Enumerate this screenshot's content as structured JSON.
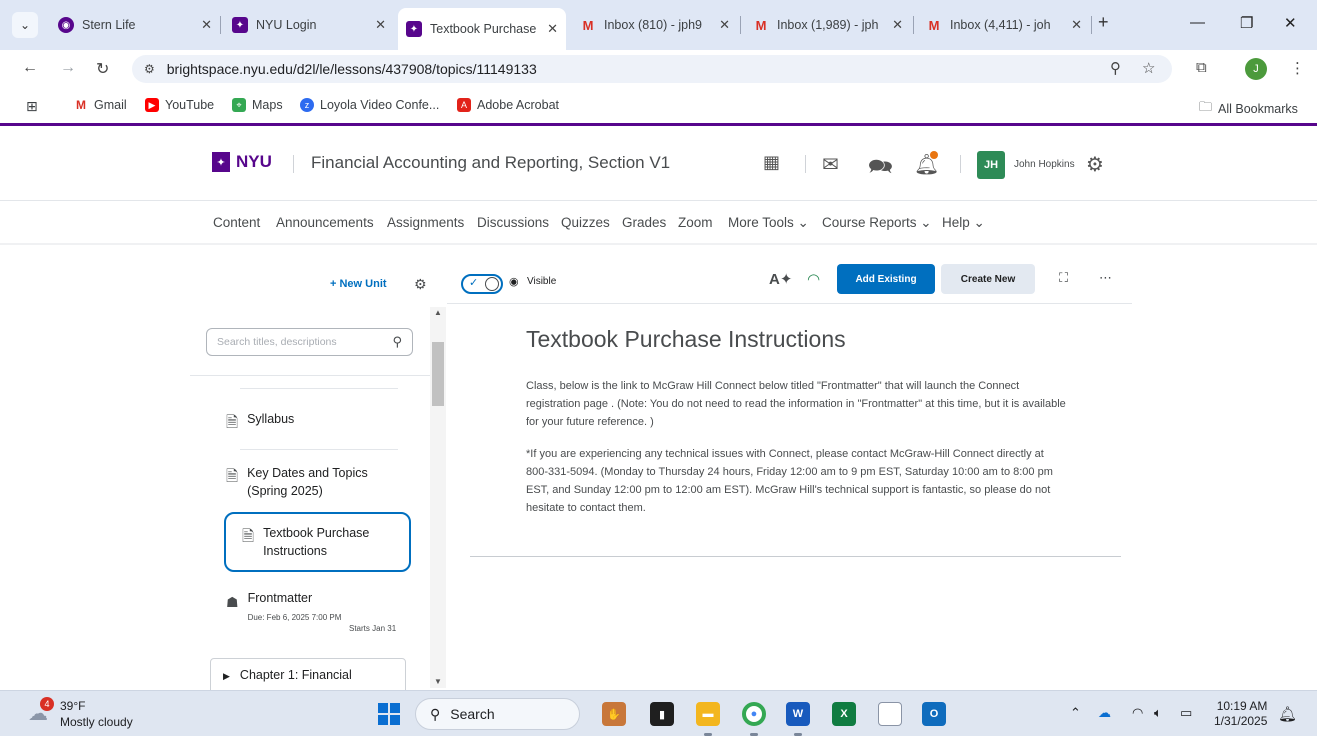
{
  "browser": {
    "tabs": [
      {
        "title": "Stern Life",
        "icon": "stern-icon"
      },
      {
        "title": "NYU Login",
        "icon": "nyu-icon"
      },
      {
        "title": "Textbook Purchase",
        "icon": "nyu-icon",
        "active": true
      },
      {
        "title": "Inbox (810) - jph9",
        "icon": "gmail-icon"
      },
      {
        "title": "Inbox (1,989) - jph",
        "icon": "gmail-icon"
      },
      {
        "title": "Inbox (4,411) - joh",
        "icon": "gmail-icon"
      }
    ],
    "url": "brightspace.nyu.edu/d2l/le/lessons/437908/topics/11149133",
    "profile_initial": "J",
    "bookmarks": [
      "Gmail",
      "YouTube",
      "Maps",
      "Loyola Video Confe...",
      "Adobe Acrobat"
    ],
    "all_bookmarks": "All Bookmarks"
  },
  "course": {
    "logo_text": "NYU",
    "title": "Financial Accounting and Reporting, Section V1",
    "user_initials": "JH",
    "user_name": "John Hopkins",
    "nav": [
      "Content",
      "Announcements",
      "Assignments",
      "Discussions",
      "Quizzes",
      "Grades",
      "Zoom",
      "More Tools ⌄",
      "Course Reports ⌄",
      "Help ⌄"
    ]
  },
  "left_panel": {
    "new_unit": "+ New Unit",
    "search_placeholder": "Search titles, descriptions",
    "items": [
      {
        "title": "Syllabus"
      },
      {
        "title": "Key Dates and Topics (Spring 2025)"
      },
      {
        "title": "Textbook Purchase Instructions",
        "active": true
      },
      {
        "title": "Frontmatter",
        "due": "Due: Feb 6, 2025 7:00 PM",
        "starts": "Starts Jan 31"
      }
    ],
    "chapter": "Chapter 1: Financial"
  },
  "content": {
    "visible_label": "Visible",
    "add_existing": "Add Existing",
    "create_new": "Create New",
    "title": "Textbook Purchase Instructions",
    "para1": "Class, below is the link to McGraw Hill Connect below titled \"Frontmatter\" that will launch the Connect registration page .  (Note: You do not need to read the information in \"Frontmatter\" at this time, but it is available for your future reference. )",
    "para2": "*If you are experiencing any technical issues with Connect, please contact McGraw-Hill Connect directly at 800-331-5094. (Monday to Thursday 24 hours, Friday 12:00 am to 9 pm EST, Saturday 10:00 am to 8:00 pm EST, and Sunday 12:00 pm to 12:00 am EST). McGraw Hill's technical support is fantastic, so please do not hesitate to contact them."
  },
  "taskbar": {
    "weather_badge": "4",
    "temp": "39°F",
    "condition": "Mostly cloudy",
    "search": "Search",
    "time": "10:19 AM",
    "date": "1/31/2025"
  },
  "colors": {
    "nyu_purple": "#57068c",
    "brightspace_blue": "#006fbf"
  }
}
